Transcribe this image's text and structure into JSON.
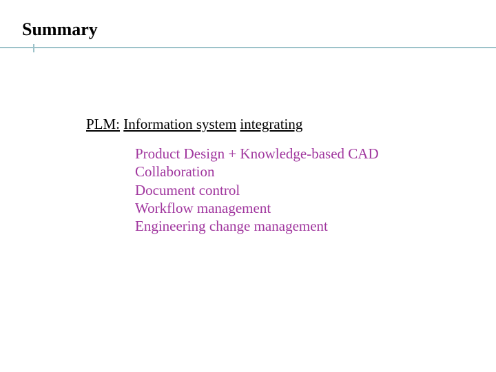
{
  "title": "Summary",
  "subheading": {
    "label": "PLM:",
    "mid": "Information system",
    "tail": "integrating"
  },
  "items": [
    "Product Design + Knowledge-based CAD",
    "Collaboration",
    "Document control",
    "Workflow management",
    "Engineering change management"
  ],
  "colors": {
    "rule": "#9cc2c9",
    "item_text": "#a0369e"
  }
}
